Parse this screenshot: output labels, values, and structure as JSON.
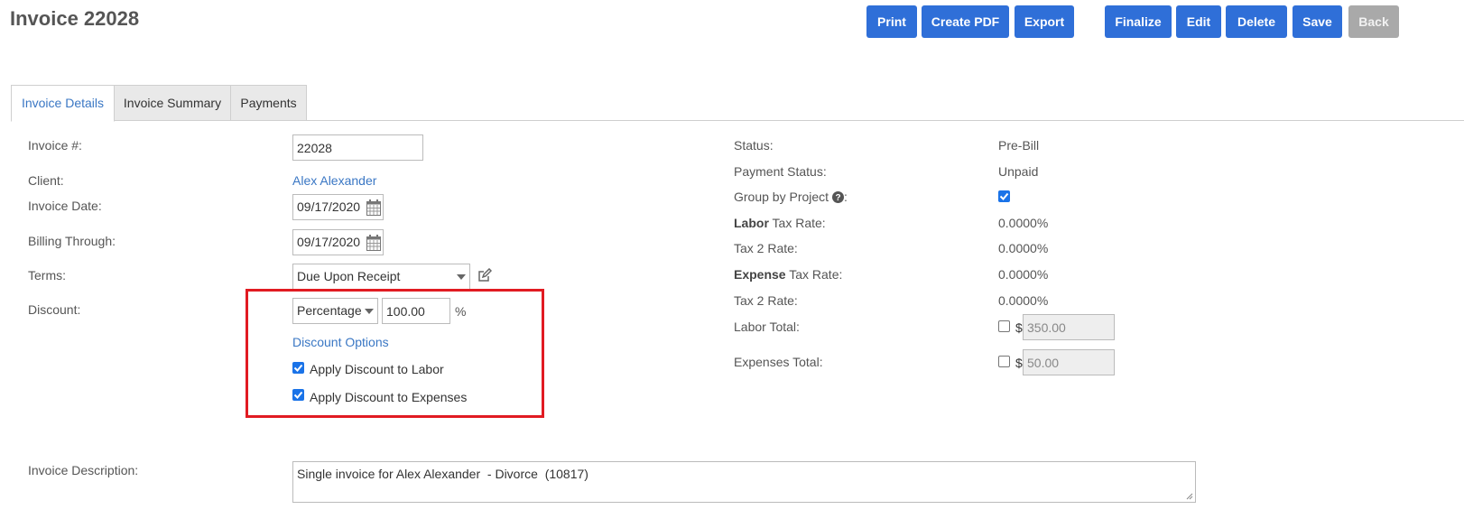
{
  "header": {
    "title": "Invoice 22028"
  },
  "toolbar": {
    "print": "Print",
    "create_pdf": "Create PDF",
    "export": "Export",
    "finalize": "Finalize",
    "edit": "Edit",
    "delete": "Delete",
    "save": "Save",
    "back": "Back"
  },
  "tabs": [
    "Invoice Details",
    "Invoice Summary",
    "Payments"
  ],
  "left": {
    "invoice_no_label": "Invoice #:",
    "invoice_no_value": "22028",
    "client_label": "Client:",
    "client_value": "Alex Alexander",
    "invoice_date_label": "Invoice Date:",
    "invoice_date_value": "09/17/2020",
    "billing_through_label": "Billing Through:",
    "billing_through_value": "09/17/2020",
    "terms_label": "Terms:",
    "terms_value": "Due Upon Receipt",
    "discount_label": "Discount:",
    "discount_type": "Percentage",
    "discount_value": "100.00",
    "discount_unit": "%",
    "discount_options": "Discount Options",
    "apply_labor": "Apply Discount to Labor",
    "apply_expenses": "Apply Discount to Expenses",
    "description_label": "Invoice Description:",
    "description_value": "Single invoice for Alex Alexander  - Divorce  (10817)"
  },
  "right": {
    "status_label": "Status:",
    "status_value": "Pre-Bill",
    "payment_status_label": "Payment Status:",
    "payment_status_value": "Unpaid",
    "group_by_project_label": "Group by Project",
    "labor_tax_bold": "Labor",
    "labor_tax_label": " Tax Rate:",
    "labor_tax_value": "0.0000%",
    "tax2_label_1": "Tax 2 Rate:",
    "tax2_value_1": "0.0000%",
    "expense_tax_bold": "Expense",
    "expense_tax_label": " Tax Rate:",
    "expense_tax_value": "0.0000%",
    "tax2_label_2": "Tax 2 Rate:",
    "tax2_value_2": "0.0000%",
    "labor_total_label": "Labor Total:",
    "labor_total_value": "350.00",
    "expenses_total_label": "Expenses Total:",
    "expenses_total_value": "50.00",
    "currency": "$"
  },
  "colors": {
    "accent": "#2f6fd8",
    "link": "#3a77c4",
    "highlight": "#e11b22",
    "disabled": "#a9a9a9"
  }
}
